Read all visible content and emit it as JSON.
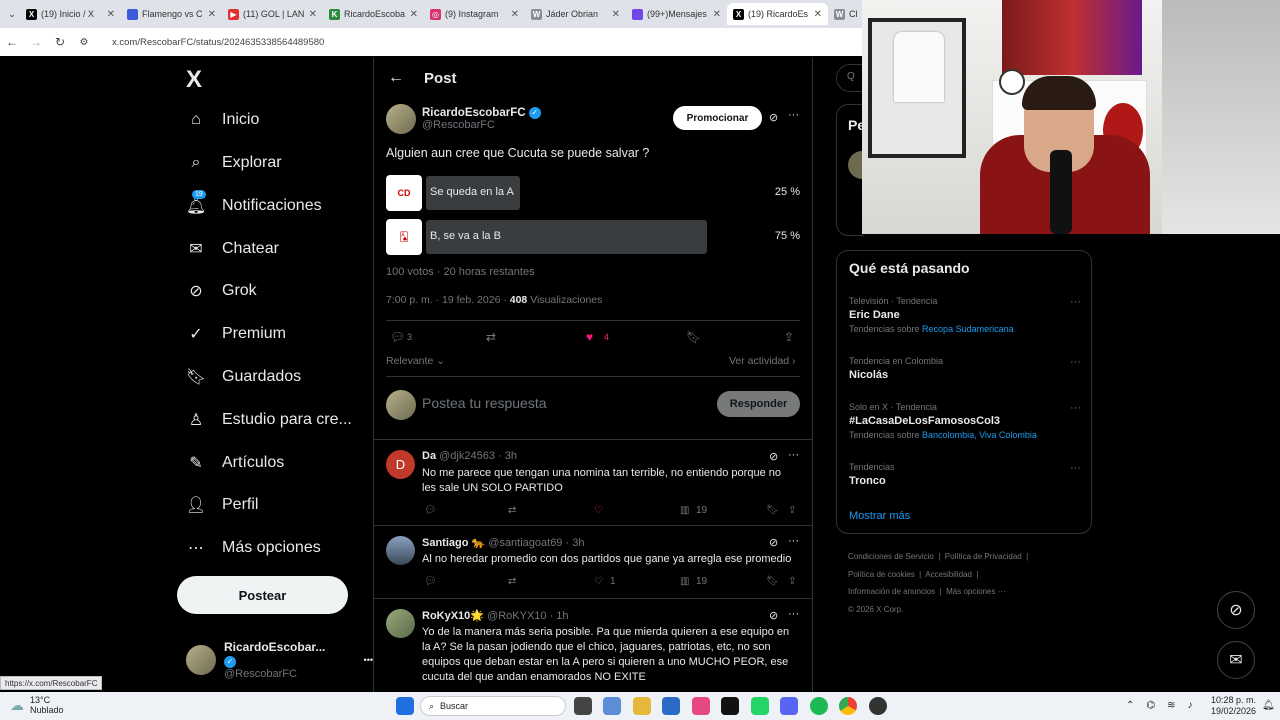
{
  "browser": {
    "tabs": [
      {
        "title": "(19) Inicio / X",
        "color": "#000000",
        "glyph": "X",
        "active": false
      },
      {
        "title": "Flamengo vs C",
        "color": "#3b5bdb",
        "glyph": "",
        "active": false
      },
      {
        "title": "(11) GOL | LAN",
        "color": "#e03131",
        "glyph": "▶",
        "active": false
      },
      {
        "title": "RicardoEscoba",
        "color": "#2b8a3e",
        "glyph": "K",
        "active": false
      },
      {
        "title": "(9) Instagram",
        "color": "#d6336c",
        "glyph": "◎",
        "active": false
      },
      {
        "title": "Jáder Obrian",
        "color": "#868e96",
        "glyph": "W",
        "active": false
      },
      {
        "title": "(99+)Mensajes",
        "color": "#7048e8",
        "glyph": "",
        "active": false
      },
      {
        "title": "(19) RicardoEs",
        "color": "#000000",
        "glyph": "X",
        "active": true
      },
      {
        "title": "Cl",
        "color": "#868e96",
        "glyph": "W",
        "active": false
      }
    ],
    "url": "x.com/RescobarFC/status/2024635338564489580",
    "status_url": "https://x.com/RescobarFC"
  },
  "sidebar": {
    "logo": "X",
    "notif_badge": "19",
    "items": [
      {
        "label": "Inicio",
        "icon": "home-icon"
      },
      {
        "label": "Explorar",
        "icon": "search-icon"
      },
      {
        "label": "Notificaciones",
        "icon": "bell-icon"
      },
      {
        "label": "Chatear",
        "icon": "mail-icon"
      },
      {
        "label": "Grok",
        "icon": "grok-icon"
      },
      {
        "label": "Premium",
        "icon": "premium-icon"
      },
      {
        "label": "Guardados",
        "icon": "bookmark-icon"
      },
      {
        "label": "Estudio para cre...",
        "icon": "studio-icon"
      },
      {
        "label": "Artículos",
        "icon": "article-icon"
      },
      {
        "label": "Perfil",
        "icon": "person-icon"
      },
      {
        "label": "Más opciones",
        "icon": "more-icon"
      }
    ],
    "post_button": "Postear",
    "profile": {
      "name": "RicardoEscobar...",
      "handle": "@RescobarFC",
      "menu": "•••"
    }
  },
  "post": {
    "header": "Post",
    "author": {
      "name": "RicardoEscobarFC",
      "handle": "@RescobarFC"
    },
    "promote": "Promocionar",
    "text": "Alguien aun cree que Cucuta se puede salvar ?",
    "poll": [
      {
        "label": "Se queda en la A",
        "percent": "25 %",
        "share": 25
      },
      {
        "label": "B, se va a la B",
        "percent": "75 %",
        "share": 75
      }
    ],
    "poll_meta": "100 votos · 20 horas restantes",
    "time": "7:00 p. m. · 19 feb. 2026 · ",
    "views": "408",
    "views_label": " Visualizaciones",
    "replies": "3",
    "likes": "4",
    "sort": "Relevante",
    "activity": "Ver actividad",
    "reply_placeholder": "Postea tu respuesta",
    "reply_button": "Responder"
  },
  "replies": [
    {
      "name": "Da",
      "handle": "@djk24563 · 3h",
      "text": "No me parece que tengan una nomina tan terrible, no entiendo porque no les sale UN SOLO PARTIDO",
      "likes": "",
      "views": "19",
      "avatar_color": "#c0392b",
      "initial": "D"
    },
    {
      "name": "Santiago 🐆",
      "handle": "@santiagoat69 · 3h",
      "text": "Al no heredar promedio con dos partidos que gane ya arregla ese promedio",
      "likes": "1",
      "views": "19",
      "avatar_color": "#4a6a8a",
      "initial": ""
    },
    {
      "name": "RoKyX10🌟",
      "handle": "@RoKYX10 · 1h",
      "text": "Yo de la manera más seria posible. Pa que mierda quieren a ese equipo en la A? Se la pasan jodiendo que el chico, jaguares, patriotas, etc, no son equipos que deban estar en la A pero si quieren a uno MUCHO PEOR, ese cucuta del que andan enamorados NO EXITE",
      "likes": "",
      "views": "",
      "avatar_color": "#7a8a6a",
      "initial": ""
    }
  ],
  "trends": {
    "title": "Qué está pasando",
    "items": [
      {
        "context": "Televisión · Tendencia",
        "name": "Eric Dane",
        "sub_prefix": "Tendencias sobre ",
        "sub_link": "Recopa Sudamericana"
      },
      {
        "context": "Tendencia en Colombia",
        "name": "Nicolás",
        "sub_prefix": "",
        "sub_link": ""
      },
      {
        "context": "Solo en X · Tendencia",
        "name": "#LaCasaDeLosFamososCol3",
        "sub_prefix": "Tendencias sobre ",
        "sub_link": "Bancolombia, Viva Colombia"
      },
      {
        "context": "Tendencias",
        "name": "Tronco",
        "sub_prefix": "",
        "sub_link": ""
      }
    ],
    "more": "Mostrar más"
  },
  "footer": {
    "links": [
      "Condiciones de Servicio",
      "Política de Privacidad",
      "Política de cookies",
      "Accesibilidad",
      "Información de anuncios",
      "Más opciones ···"
    ],
    "copyright": "© 2026 X Corp."
  },
  "right_partial": {
    "search": "Q",
    "pe": "Pe"
  },
  "taskbar": {
    "weather_temp": "13°C",
    "weather_text": "Nublado",
    "search": "Buscar",
    "time": "10:28 p. m.",
    "date": "19/02/2026"
  }
}
